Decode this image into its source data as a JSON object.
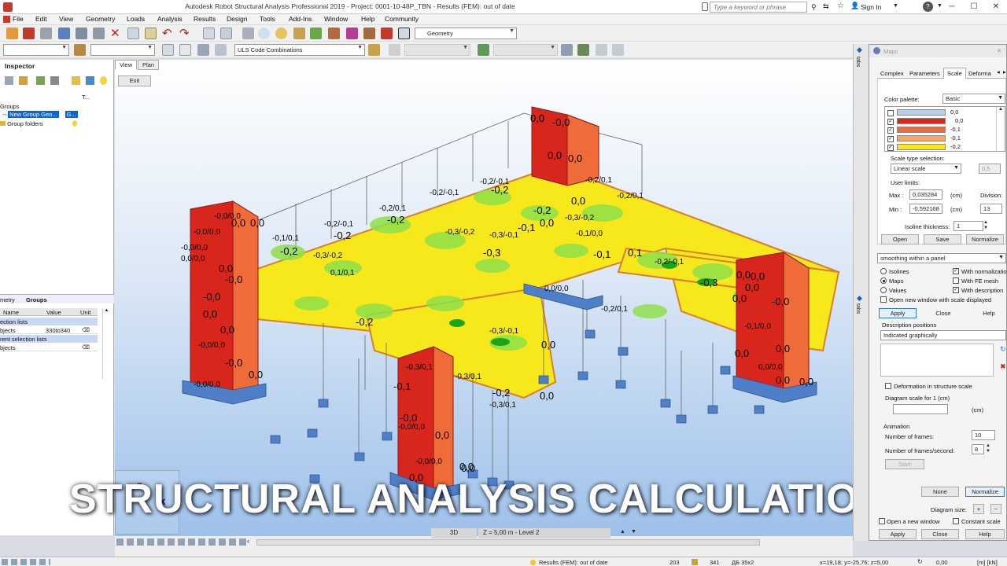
{
  "window": {
    "title": "Autodesk Robot Structural Analysis Professional 2019 - Project: 0001-10-48P_TBN - Results (FEM): out of date",
    "search_placeholder": "Type a keyword or phrase",
    "sign_in": "Sign In",
    "help": "?"
  },
  "menu": [
    "File",
    "Edit",
    "View",
    "Geometry",
    "Loads",
    "Analysis",
    "Results",
    "Design",
    "Tools",
    "Add-Ins",
    "Window",
    "Help",
    "Community"
  ],
  "toolbar": {
    "geometry_combo": "Geometry",
    "load_combo": "ULS Code Combinations"
  },
  "inspector": {
    "title": "Inspector",
    "col_t": "T...",
    "groups_root": "Groups",
    "new_group": "New Group Geo...",
    "new_group_type": "G...",
    "group_folders": "Group folders",
    "tabs": [
      "metry",
      "Groups"
    ],
    "table_headers": [
      "Name",
      "Value",
      "Unit"
    ],
    "rows": [
      {
        "name": "ection lists",
        "value": "",
        "section": true
      },
      {
        "name": "bjects",
        "value": "330to340",
        "section": false
      },
      {
        "name": "rent selection lists",
        "value": "",
        "section": true
      },
      {
        "name": "bjects",
        "value": "",
        "section": false
      }
    ]
  },
  "viewport": {
    "tabs": [
      "View",
      "Plan"
    ],
    "exit": "Exit",
    "labels": [
      "0,0",
      "-0,0",
      "0,0",
      "0,0",
      "0,0",
      "-0,0/0,0",
      "0,0",
      "0,0",
      "-0,0/0,0",
      "-0,0",
      "0,0/0,0",
      "-0,0/0,0",
      "-0,0",
      "0,0",
      "0,0",
      "-0,0/0,0",
      "-0,0",
      "0,0",
      "-0,0/0,0",
      "-0,1/0,1",
      "-0,2/-0,1",
      "-0,2",
      "-0,2",
      "-0,3/-0,2",
      "-0,2/0,1",
      "-0,2",
      "-0,2/-0,1",
      "-0,3/-0,2",
      "-0,1",
      "-0,2",
      "-0,3",
      "-0,3/-0,1",
      "-0,2/-0,1",
      "0,0",
      "-0,1/0,0",
      "-0,2",
      "-0,3/-0,2",
      "-0,2/0,1",
      "0,0",
      "0,1",
      "-0,2/0,1",
      "0,0",
      "-0,2/-0,1",
      "0,0/0,0",
      "-0,3",
      "0,0",
      "-0,1",
      "-0,2/0,1",
      "-0,3/0,1",
      "0,0",
      "-0,1",
      "-0,3/0,1",
      "-0,2",
      "-0,3/-0,1",
      "0,1/0,1",
      "-0,2",
      "-0,3/0,1",
      "0,0",
      "0,0",
      "0,0",
      "0,0",
      "-0,0/0,0",
      "-0,0",
      "0,0",
      "-0,0/0,0",
      "0,0",
      "-0,1/0,0",
      "0,0",
      "-0,0",
      "0,0",
      "0,0",
      "0,0/0,0",
      "0,0",
      "0,0"
    ],
    "bottom_view": "3D",
    "bottom_level": "Z = 5,00 m - Level 2"
  },
  "overlay_title": "STRUCTURAL ANALYSIS CALCULATIONS",
  "maps": {
    "title": "Maps",
    "tabs": [
      "Complex",
      "Parameters",
      "Scale",
      "Deforma"
    ],
    "palette_label": "Color palette:",
    "palette_value": "Basic",
    "scale_entries": [
      {
        "value": "0,0",
        "color": "#b9cdec",
        "checked": false
      },
      {
        "value": "0,0",
        "color": "#d8261c",
        "checked": true
      },
      {
        "value": "-0,1",
        "color": "#f06b3a",
        "checked": true
      },
      {
        "value": "-0,1",
        "color": "#f6a567",
        "checked": true
      },
      {
        "value": "-0,2",
        "color": "#f6e81a",
        "checked": true
      }
    ],
    "scale_type_label": "Scale type selection:",
    "scale_type": "Linear scale",
    "scale_type_value": "0,5",
    "user_limits": "User limits:",
    "max_label": "Max :",
    "max_value": "0,035284",
    "min_label": "Min :",
    "min_value": "-0,592168",
    "unit": "(cm)",
    "division_label": "Division:",
    "division_value": "13",
    "isoline_label": "Isoline thickness:",
    "isoline_value": "1",
    "btn_open": "Open",
    "btn_save": "Save",
    "btn_normalize": "Normalize",
    "smoothing": "smoothing within a panel",
    "radios": [
      "Isolines",
      "Maps",
      "Values"
    ],
    "checks_right": [
      "With normalization",
      "With FE mesh",
      "With description"
    ],
    "open_new_window": "Open new window with scale displayed",
    "btn_apply": "Apply",
    "btn_close": "Close",
    "btn_help": "Help",
    "desc_positions": "Description positions",
    "desc_value": "Indicated graphically",
    "deformation_scale": "Deformation in structure scale",
    "diagram_scale": "Diagram scale for 1   (cm)",
    "diagram_unit": "(cm)",
    "animation": "Animation",
    "frames_label": "Number of frames:",
    "frames_value": "10",
    "fps_label": "Number of frames/second:",
    "fps_value": "8",
    "start": "Start",
    "btn_none": "None",
    "btn_normalize2": "Normalize",
    "diagram_size": "Diagram size:",
    "open_new_window2": "Open a new window",
    "constant_scale": "Constant scale",
    "btn_apply2": "Apply",
    "btn_close2": "Close",
    "btn_help2": "Help"
  },
  "side_tabs": [
    "tabs",
    "tabs"
  ],
  "status": {
    "results": "Results (FEM): out of date",
    "n1": "203",
    "n2": "341",
    "section": "ДБ 35x2",
    "coords": "x=19,18; y=-25,76; z=5,00",
    "rot": "0,00",
    "units": "[m] [kN]"
  },
  "colors": {
    "red": "#d8261c",
    "orange": "#f06b3a",
    "yellow": "#f6e81a",
    "green": "#8ee04a",
    "support": "#4f7fc7"
  }
}
